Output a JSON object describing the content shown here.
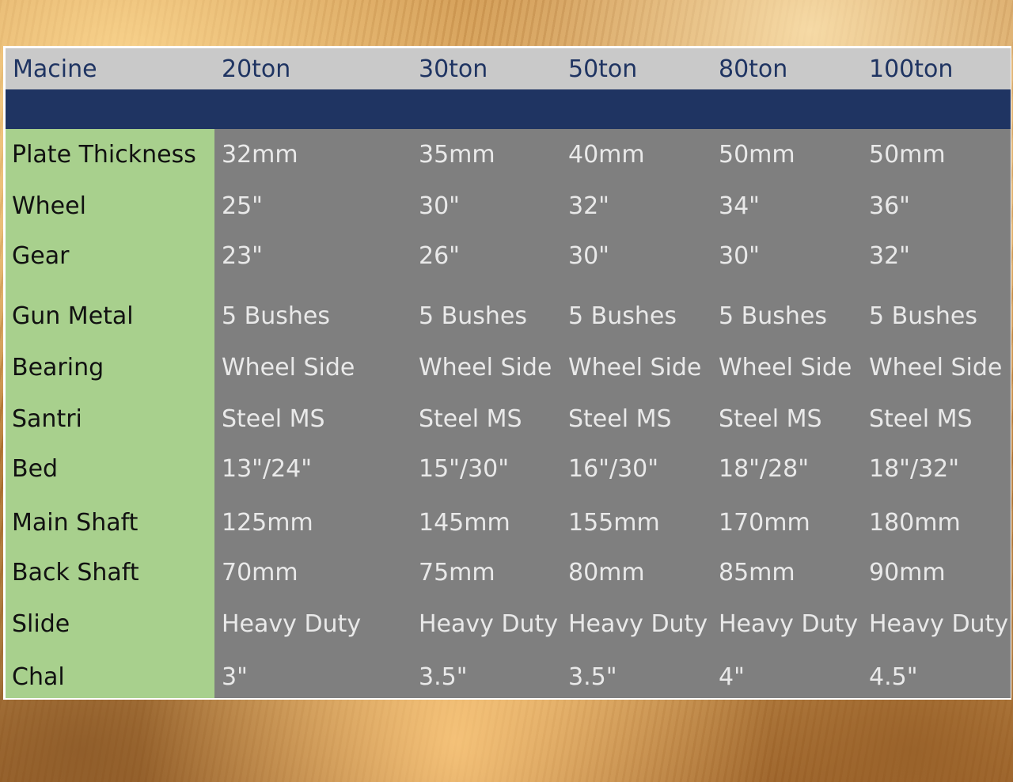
{
  "table": {
    "header": [
      "Macine",
      "20ton",
      "30ton",
      "50ton",
      "80ton",
      "100ton"
    ],
    "rows": [
      {
        "label": "Plate Thickness",
        "values": [
          "32mm",
          "35mm",
          "40mm",
          "50mm",
          "50mm"
        ]
      },
      {
        "label": "Wheel",
        "values": [
          "25\"",
          "30\"",
          "32\"",
          "34\"",
          "36\""
        ]
      },
      {
        "label": "Gear",
        "values": [
          "23\"",
          "26\"",
          "30\"",
          "30\"",
          "32\""
        ]
      },
      {
        "label": "Gun Metal",
        "values": [
          "5 Bushes",
          "5 Bushes",
          "5 Bushes",
          "5 Bushes",
          "5 Bushes"
        ]
      },
      {
        "label": "Bearing",
        "values": [
          "Wheel Side",
          "Wheel Side",
          "Wheel Side",
          "Wheel Side",
          "Wheel Side"
        ]
      },
      {
        "label": "Santri",
        "values": [
          "Steel MS",
          "Steel MS",
          "Steel MS",
          "Steel MS",
          "Steel MS"
        ]
      },
      {
        "label": "Bed",
        "values": [
          "13\"/24\"",
          "15\"/30\"",
          "16\"/30\"",
          "18\"/28\"",
          "18\"/32\""
        ]
      },
      {
        "label": "Main Shaft",
        "values": [
          "125mm",
          "145mm",
          "155mm",
          "170mm",
          "180mm"
        ]
      },
      {
        "label": "Back Shaft",
        "values": [
          "70mm",
          "75mm",
          "80mm",
          "85mm",
          "90mm"
        ]
      },
      {
        "label": "Slide",
        "values": [
          "Heavy Duty",
          "Heavy Duty",
          "Heavy Duty",
          "Heavy Duty",
          "Heavy Duty"
        ]
      },
      {
        "label": "Chal",
        "values": [
          "3\"",
          "3.5\"",
          "3.5\"",
          "4\"",
          "4.5\""
        ]
      }
    ]
  },
  "colors": {
    "header_bg": "#c9c9c9",
    "band": "#1f3462",
    "label_bg": "#a8d08d",
    "data_bg": "#7f7f7f"
  }
}
